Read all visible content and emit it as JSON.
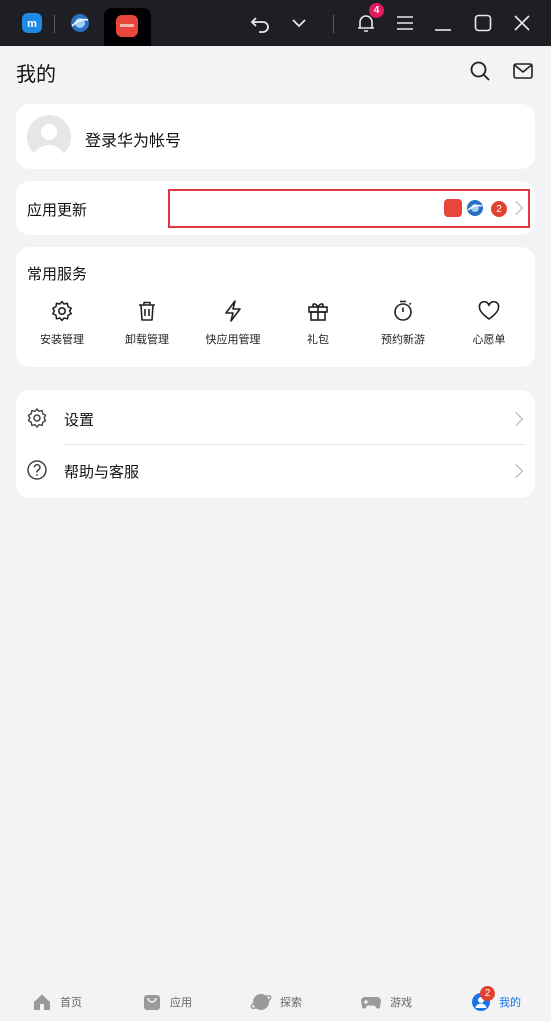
{
  "titlebar": {
    "notification_count": "4",
    "icons": [
      "multi-app-logo-icon",
      "browser-app-icon",
      "huawei-appgallery-icon",
      "undo-icon",
      "chevron-down-icon",
      "bell-icon",
      "menu-icon",
      "minimize-icon",
      "maximize-icon",
      "close-icon"
    ]
  },
  "header": {
    "title": "我的",
    "icons": [
      "search-icon",
      "mail-icon"
    ]
  },
  "account": {
    "login_label": "登录华为帐号"
  },
  "updates": {
    "label": "应用更新",
    "count": "2"
  },
  "services": {
    "title": "常用服务",
    "items": [
      {
        "label": "安装管理",
        "icon": "gear-icon"
      },
      {
        "label": "卸载管理",
        "icon": "trash-icon"
      },
      {
        "label": "快应用管理",
        "icon": "lightning-icon"
      },
      {
        "label": "礼包",
        "icon": "gift-icon"
      },
      {
        "label": "预约新游",
        "icon": "stopwatch-icon"
      },
      {
        "label": "心愿单",
        "icon": "heart-icon"
      }
    ]
  },
  "settings_list": [
    {
      "label": "设置",
      "icon": "gear-icon"
    },
    {
      "label": "帮助与客服",
      "icon": "help-icon"
    }
  ],
  "bottom_nav": [
    {
      "label": "首页",
      "icon": "home-icon"
    },
    {
      "label": "应用",
      "icon": "app-bag-icon"
    },
    {
      "label": "探索",
      "icon": "planet-icon"
    },
    {
      "label": "游戏",
      "icon": "gamepad-icon"
    },
    {
      "label": "我的",
      "icon": "profile-icon",
      "active": true,
      "badge": "2"
    }
  ],
  "colors": {
    "accent": "#1a73e8",
    "badge": "#e0432f",
    "highlight": "#e0393f"
  }
}
